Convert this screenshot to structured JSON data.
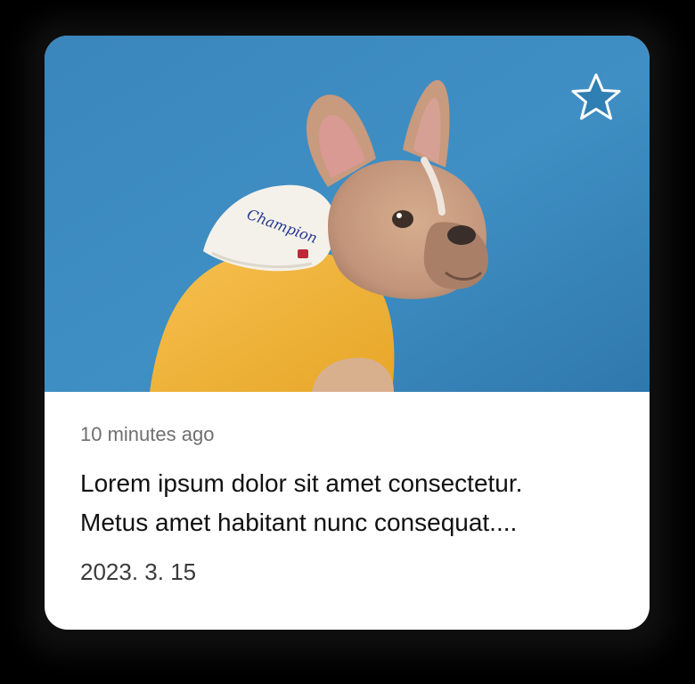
{
  "card": {
    "timestamp": "10 minutes ago",
    "title_line_1": "Lorem ipsum dolor sit amet consectetur.",
    "title_line_2": "Metus amet habitant nunc consequat....",
    "date": "2023. 3. 15",
    "image_text": "Champion",
    "favorite_icon": "star-outline-icon"
  },
  "colors": {
    "photo_background": "#3f8fc4",
    "hoodie": "#f1b13a",
    "hood": "#f3f1ea",
    "dog": "#c79b7d",
    "star_stroke": "#ffffff",
    "star_fill": "#2f7fb3"
  }
}
